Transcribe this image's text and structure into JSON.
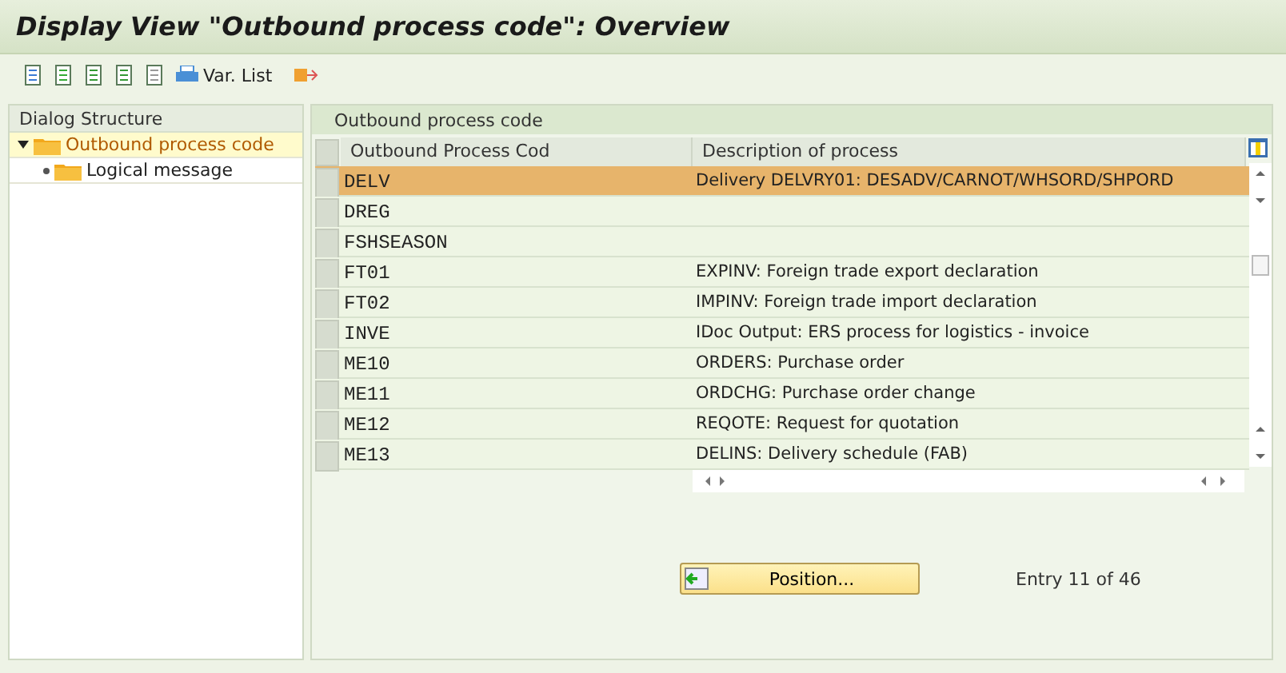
{
  "window": {
    "title": "Display View \"Outbound process code\": Overview"
  },
  "toolbar": {
    "var_list": "Var. List"
  },
  "dialog_structure": {
    "title": "Dialog Structure",
    "items": [
      {
        "label": "Outbound process code",
        "selected": true,
        "expanded": true,
        "children": [
          {
            "label": "Logical message",
            "selected": false
          }
        ]
      }
    ]
  },
  "table": {
    "title": "Outbound process code",
    "columns": [
      "Outbound Process Cod",
      "Description of process"
    ],
    "rows": [
      {
        "code": "DELV",
        "description": "Delivery DELVRY01: DESADV/CARNOT/WHSORD/SHPORD",
        "selected": true
      },
      {
        "code": "DREG",
        "description": "",
        "selected": false
      },
      {
        "code": "FSHSEASON",
        "description": "",
        "selected": false
      },
      {
        "code": "FT01",
        "description": "EXPINV: Foreign trade export declaration",
        "selected": false
      },
      {
        "code": "FT02",
        "description": "IMPINV: Foreign trade import declaration",
        "selected": false
      },
      {
        "code": "INVE",
        "description": "IDoc Output: ERS process for logistics - invoice",
        "selected": false
      },
      {
        "code": "ME10",
        "description": "ORDERS: Purchase order",
        "selected": false
      },
      {
        "code": "ME11",
        "description": "ORDCHG: Purchase order change",
        "selected": false
      },
      {
        "code": "ME12",
        "description": "REQOTE: Request for quotation",
        "selected": false
      },
      {
        "code": "ME13",
        "description": "DELINS: Delivery schedule (FAB)",
        "selected": false
      }
    ]
  },
  "position_button": "Position...",
  "entry_info": "Entry 11 of 46"
}
